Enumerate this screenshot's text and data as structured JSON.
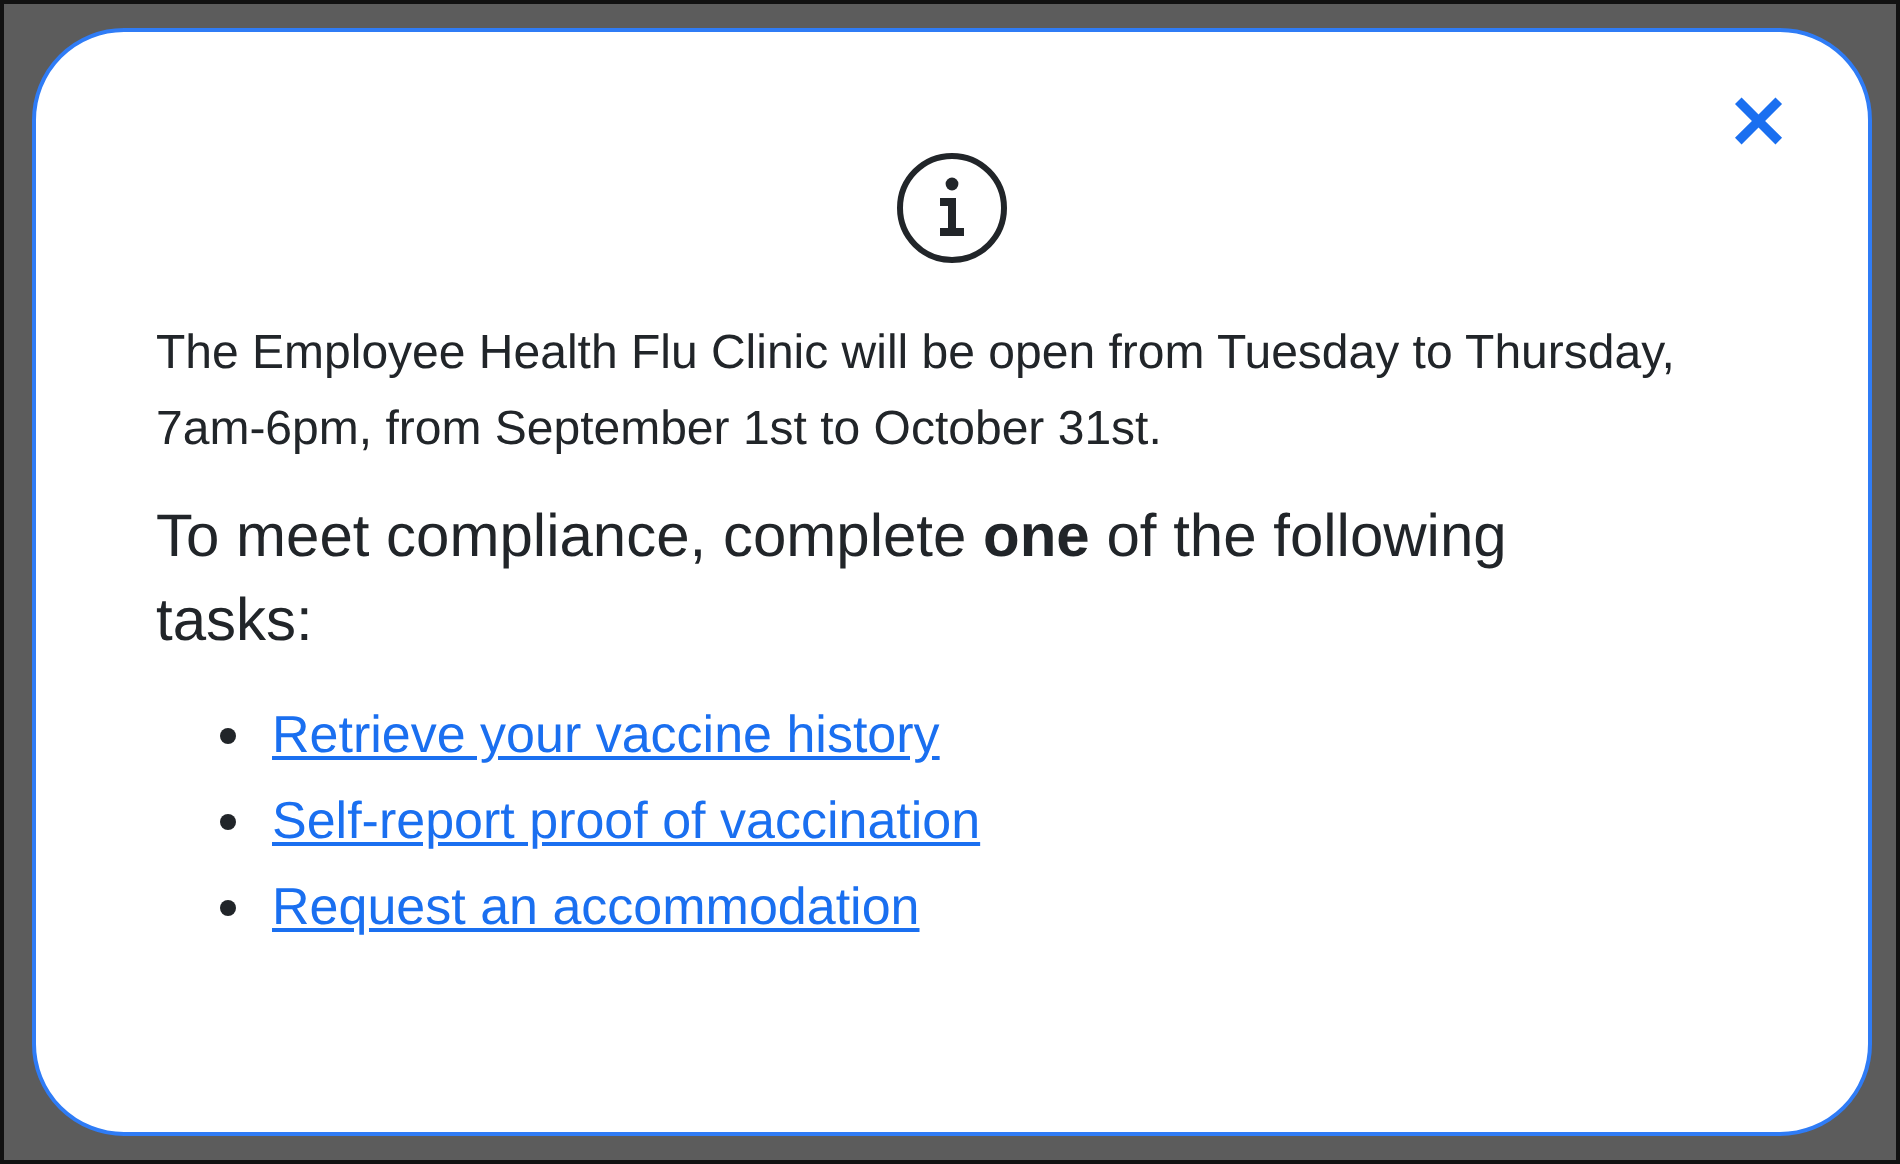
{
  "dialog": {
    "close_label": "×",
    "message": "The Employee Health Flu Clinic will be open from Tuesday to Thursday, 7am-6pm, from September 1st to October 31st.",
    "heading": "To meet compliance, complete **one** of the following tasks:",
    "tasks": [
      {
        "label": "Retrieve your vaccine history"
      },
      {
        "label": "Self-report proof of vaccination"
      },
      {
        "label": "Request an accommodation"
      }
    ]
  }
}
